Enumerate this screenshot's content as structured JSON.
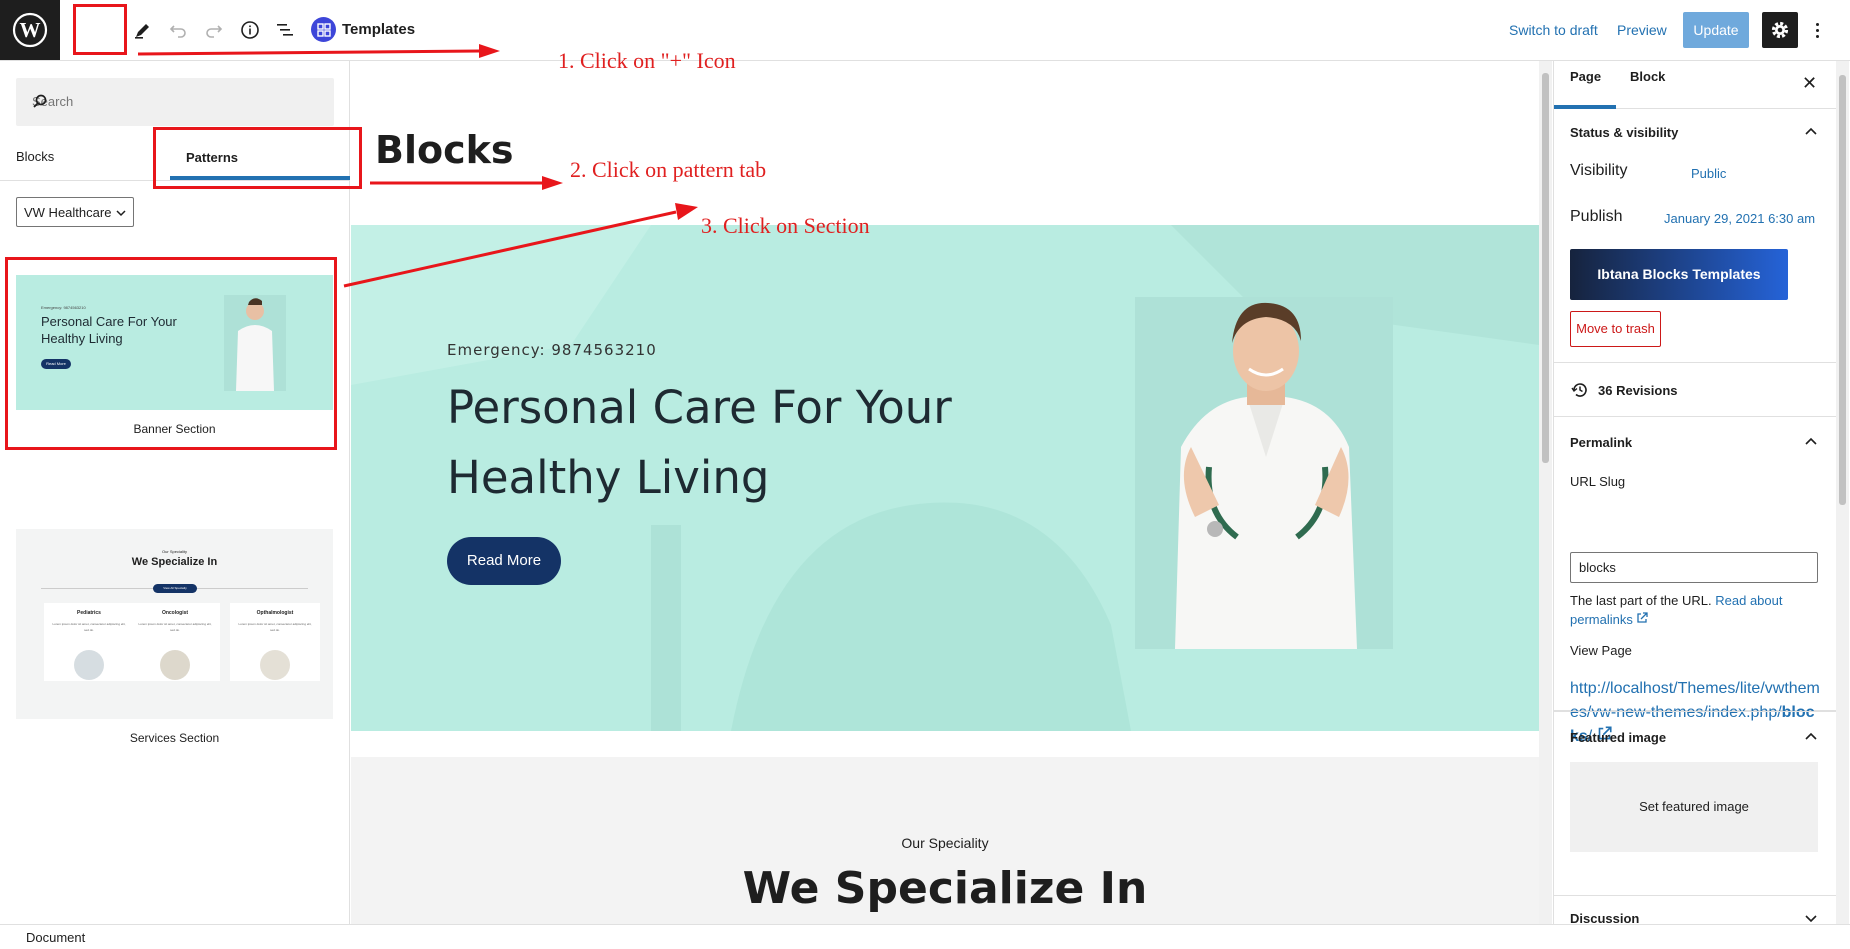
{
  "topbar": {
    "template_label": "Templates",
    "switch_to_draft": "Switch to draft",
    "preview": "Preview",
    "update": "Update"
  },
  "inserter": {
    "search_placeholder": "Search",
    "tab_blocks": "Blocks",
    "tab_patterns": "Patterns",
    "category": "VW Healthcare",
    "patterns": [
      {
        "label": "Banner Section",
        "thumb_small": "Emergency: 9874563210",
        "thumb_title": "Personal Care For Your Healthy Living",
        "thumb_btn": "Read More"
      },
      {
        "label": "Services Section",
        "thumb_small": "Our Speciality",
        "thumb_title": "We Specialize In",
        "thumb_btn": "View All Specialty",
        "cards": [
          "Pediatrics",
          "Oncologist",
          "Opthalmologist"
        ],
        "card_text": "Lorem ipsum dolor sit amet, consectetur adipiscing elit, sed do."
      }
    ]
  },
  "canvas": {
    "page_title": "Blocks",
    "banner": {
      "emergency": "Emergency: 9874563210",
      "heading": "Personal Care For Your Healthy Living",
      "button": "Read More"
    },
    "speciality_small": "Our Speciality",
    "speciality_heading": "We Specialize In"
  },
  "sidebar": {
    "tab_page": "Page",
    "tab_block": "Block",
    "status_title": "Status & visibility",
    "visibility_label": "Visibility",
    "visibility_value": "Public",
    "publish_label": "Publish",
    "publish_value": "January 29, 2021 6:30 am",
    "ibtana_button": "Ibtana Blocks Templates",
    "trash_button": "Move to trash",
    "revisions": "36 Revisions",
    "permalink_title": "Permalink",
    "url_slug_label": "URL Slug",
    "url_slug_value": "blocks",
    "permalink_help": "The last part of the URL.",
    "permalink_link": "Read about permalinks",
    "view_page_label": "View Page",
    "view_page_url": "http://localhost/Themes/lite/vwthemes/vw-new-themes/index.php/",
    "view_page_url_bold": "blocks",
    "view_page_url_tail": "/",
    "featured_title": "Featured image",
    "set_featured": "Set featured image",
    "discussion_title": "Discussion"
  },
  "footer": {
    "breadcrumb": "Document"
  },
  "annotations": {
    "step1": "1. Click on \"+\" Icon",
    "step2": "2. Click on pattern tab",
    "step3": "3. Click on Section"
  },
  "colors": {
    "accent": "#2271b1",
    "annotation": "#e8161b",
    "banner_bg": "#b9ece1",
    "button_dark": "#143366"
  }
}
